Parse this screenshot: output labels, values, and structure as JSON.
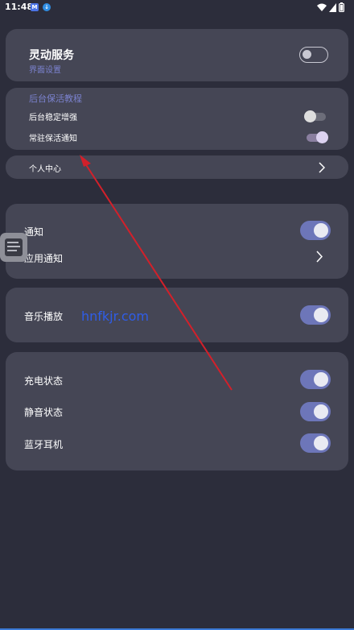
{
  "status_bar": {
    "time": "11:48",
    "app_badge_1": "M",
    "app_badge_2": "↓",
    "icons": [
      "wifi-icon",
      "signal-icon",
      "battery-icon"
    ]
  },
  "dynamic_service": {
    "title": "灵动服务",
    "subtitle": "界面设置",
    "enabled": false
  },
  "background_keep": {
    "heading": "后台保活教程",
    "items": [
      {
        "label": "后台稳定增强",
        "enabled": false
      },
      {
        "label": "常驻保活通知",
        "enabled": true
      }
    ]
  },
  "personal_center": {
    "label": "个人中心"
  },
  "notification_section": {
    "notify_label": "通知",
    "notify_enabled": true,
    "app_notify_label": "应用通知"
  },
  "music_section": {
    "label": "音乐播放",
    "enabled": true
  },
  "state_section": {
    "items": [
      {
        "label": "充电状态",
        "enabled": true
      },
      {
        "label": "静音状态",
        "enabled": true
      },
      {
        "label": "蓝牙耳机",
        "enabled": true
      }
    ]
  },
  "watermark_text": "hnfkjr.com",
  "colors": {
    "background": "#2c2d3b",
    "card": "#454655",
    "accent_toggle": "#6d76b9",
    "subtitle": "#7b82cf",
    "arrow": "#d3202a"
  }
}
